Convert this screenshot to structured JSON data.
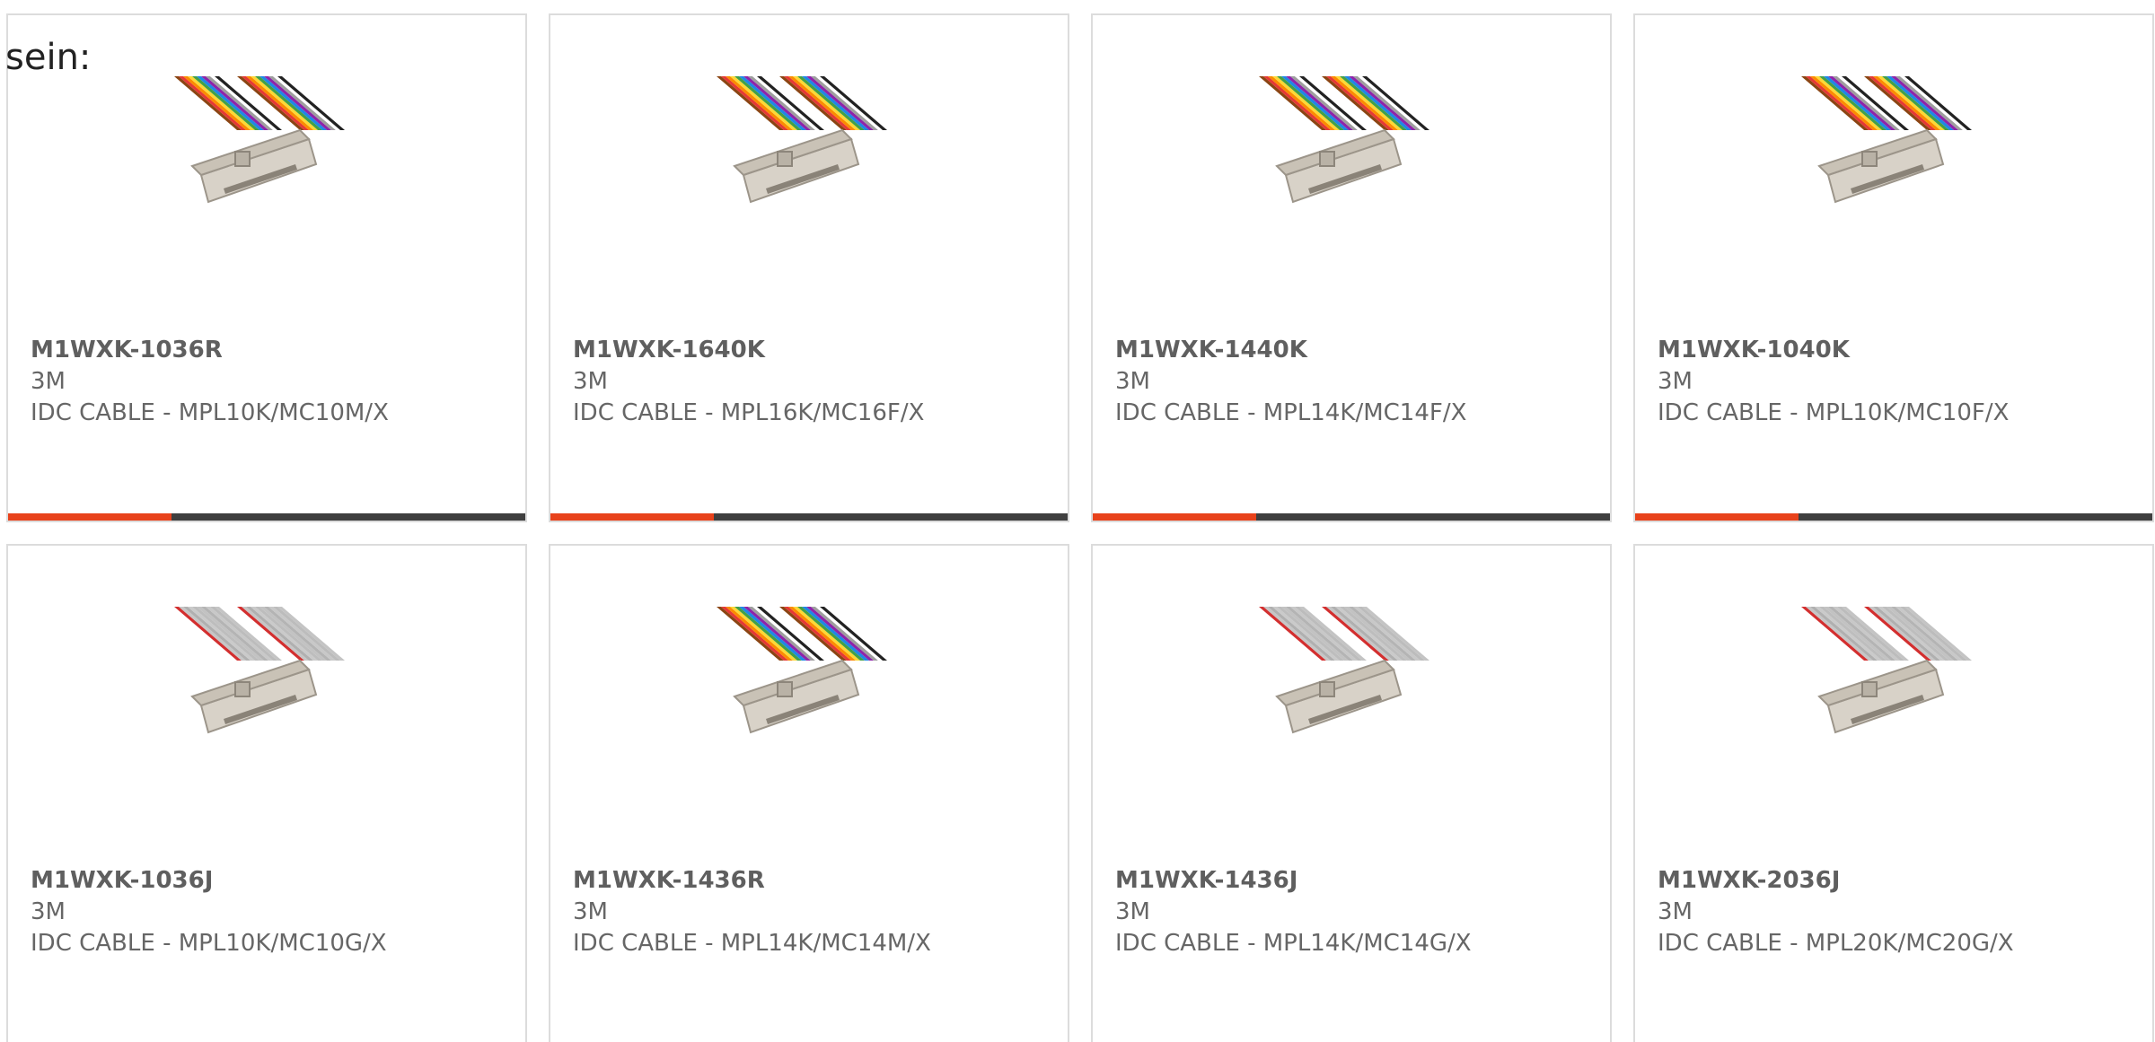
{
  "intro_text": "sein:",
  "colors": {
    "accent": "#e8421b",
    "bar": "#3f3f3f",
    "border": "#dcdcdc",
    "text": "#666666"
  },
  "products": [
    {
      "part": "M1WXK-1036R",
      "brand": "3M",
      "desc": "IDC CABLE - MPL10K/MC10M/X",
      "cable": "rainbow",
      "image": "ribbon-cable-icon"
    },
    {
      "part": "M1WXK-1640K",
      "brand": "3M",
      "desc": "IDC CABLE - MPL16K/MC16F/X",
      "cable": "rainbow",
      "image": "ribbon-cable-icon"
    },
    {
      "part": "M1WXK-1440K",
      "brand": "3M",
      "desc": "IDC CABLE - MPL14K/MC14F/X",
      "cable": "rainbow",
      "image": "ribbon-cable-icon"
    },
    {
      "part": "M1WXK-1040K",
      "brand": "3M",
      "desc": "IDC CABLE - MPL10K/MC10F/X",
      "cable": "rainbow",
      "image": "ribbon-cable-icon"
    },
    {
      "part": "M1WXK-1036J",
      "brand": "3M",
      "desc": "IDC CABLE - MPL10K/MC10G/X",
      "cable": "gray",
      "image": "ribbon-cable-icon"
    },
    {
      "part": "M1WXK-1436R",
      "brand": "3M",
      "desc": "IDC CABLE - MPL14K/MC14M/X",
      "cable": "rainbow",
      "image": "ribbon-cable-icon"
    },
    {
      "part": "M1WXK-1436J",
      "brand": "3M",
      "desc": "IDC CABLE - MPL14K/MC14G/X",
      "cable": "gray",
      "image": "ribbon-cable-icon"
    },
    {
      "part": "M1WXK-2036J",
      "brand": "3M",
      "desc": "IDC CABLE - MPL20K/MC20G/X",
      "cable": "gray",
      "image": "ribbon-cable-icon"
    }
  ]
}
